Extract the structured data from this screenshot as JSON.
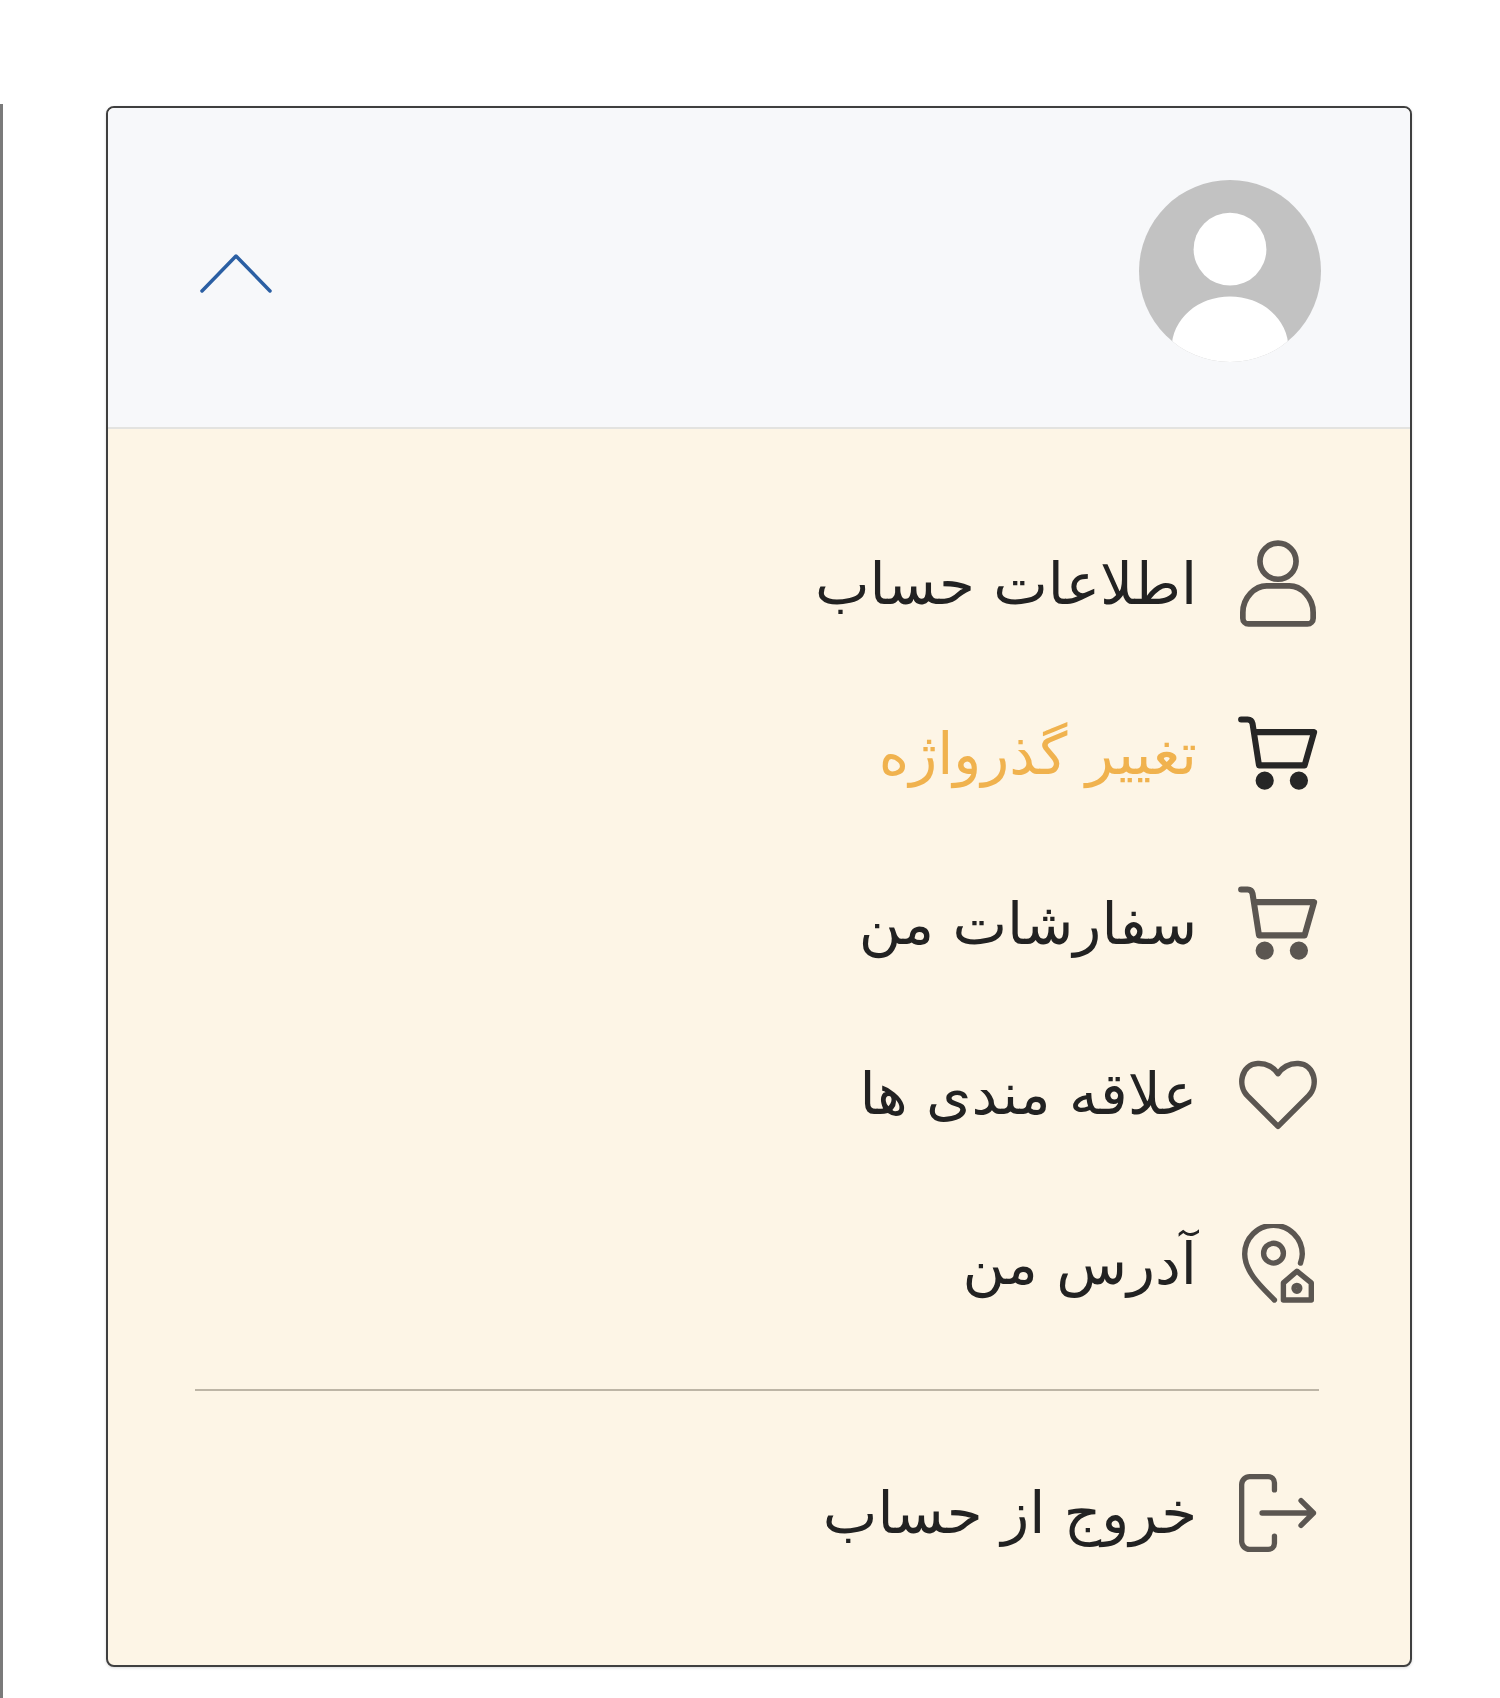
{
  "header": {
    "expanded": true
  },
  "menu": {
    "items": [
      {
        "label": "اطلاعات حساب",
        "selected": false
      },
      {
        "label": "تغییر گذرواژه",
        "selected": true
      },
      {
        "label": "سفارشات من",
        "selected": false
      },
      {
        "label": "علاقه مندی ها",
        "selected": false
      },
      {
        "label": "آدرس من",
        "selected": false
      }
    ]
  },
  "logout": {
    "label": "خروج از حساب"
  }
}
